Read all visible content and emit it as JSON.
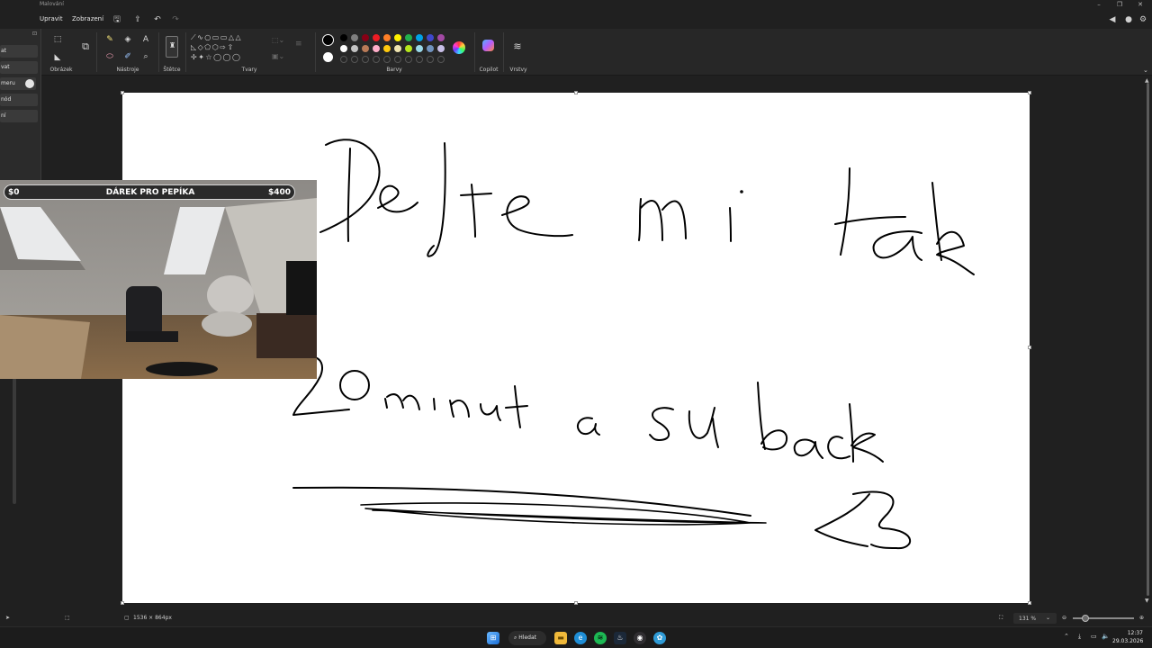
{
  "window": {
    "title": "Malování"
  },
  "menu": {
    "edit": "Upravit",
    "view": "Zobrazení"
  },
  "ribbon": {
    "groups": {
      "image": "Obrázek",
      "tools": "Nástroje",
      "brushes": "Štětce",
      "shapes": "Tvary",
      "colors": "Barvy",
      "copilot": "Copilot",
      "layers": "Vrstvy"
    },
    "colors": {
      "primary": "#000000",
      "secondary": "#ffffff",
      "row1": [
        "#000000",
        "#7f7f7f",
        "#880015",
        "#ed1c24",
        "#ff7f27",
        "#fff200",
        "#22b14c",
        "#00a2e8",
        "#3f48cc",
        "#a349a4"
      ],
      "row2": [
        "#ffffff",
        "#c3c3c3",
        "#b97a57",
        "#ffaec9",
        "#ffc90e",
        "#efe4b0",
        "#b5e61d",
        "#99d9ea",
        "#7092be",
        "#c8bfe7"
      ]
    }
  },
  "sidebar": {
    "items": [
      "at",
      "vat",
      "meru",
      "nód",
      "ní"
    ]
  },
  "webcam": {
    "left_amount": "$0",
    "title": "DÁREK PRO PEPÍKA",
    "right_amount": "$400"
  },
  "status": {
    "dimensions": "1536 × 864px",
    "zoom": "131 %"
  },
  "taskbar": {
    "search_label": "Hledat",
    "time": "12:37",
    "date": "29.03.2026"
  }
}
